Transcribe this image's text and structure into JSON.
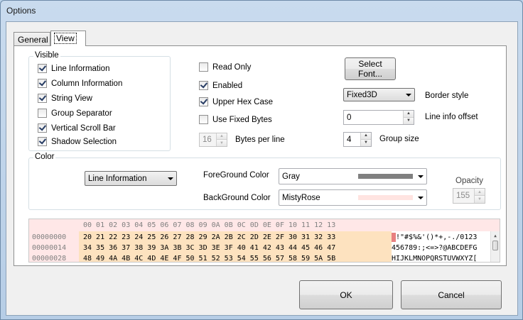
{
  "window": {
    "title": "Options"
  },
  "tabs": [
    {
      "label": "General"
    },
    {
      "label": "View"
    }
  ],
  "visible_group": {
    "title": "Visible",
    "items": [
      {
        "label": "Line Information",
        "checked": true
      },
      {
        "label": "Column Information",
        "checked": true
      },
      {
        "label": "String View",
        "checked": true
      },
      {
        "label": "Group Separator",
        "checked": false
      },
      {
        "label": "Vertical Scroll Bar",
        "checked": true
      },
      {
        "label": "Shadow Selection",
        "checked": true
      }
    ]
  },
  "options": {
    "read_only": {
      "label": "Read Only",
      "checked": false
    },
    "enabled": {
      "label": "Enabled",
      "checked": true
    },
    "upper_hex": {
      "label": "Upper Hex Case",
      "checked": true
    },
    "fixed_bytes": {
      "label": "Use Fixed Bytes",
      "checked": false
    },
    "bytes_per_line": {
      "label": "Bytes per line",
      "value": "16"
    }
  },
  "right": {
    "select_font": "Select Font...",
    "border_style": {
      "label": "Border style",
      "value": "Fixed3D"
    },
    "line_info_offset": {
      "label": "Line info offset",
      "value": "0"
    },
    "group_size": {
      "label": "Group size",
      "value": "4"
    }
  },
  "color_group": {
    "title": "Color",
    "target": "Line Information",
    "foreground": {
      "label": "ForeGround Color",
      "value": "Gray",
      "swatch": "#808080"
    },
    "background": {
      "label": "BackGround Color",
      "value": "MistyRose",
      "swatch": "#ffe4e1"
    },
    "opacity": {
      "label": "Opacity",
      "value": "155"
    }
  },
  "hex_preview": {
    "header": "00 01 02 03 04 05 06 07 08 09 0A 0B 0C 0D 0E 0F 10 11 12 13",
    "rows": [
      {
        "addr": "00000000",
        "bytes": "20 21 22 23 24 25 26 27 28 29 2A 2B 2C 2D 2E 2F 30 31 32 33",
        "ascii": "!\"#$%&'()*+,-./0123"
      },
      {
        "addr": "00000014",
        "bytes": "34 35 36 37 38 39 3A 3B 3C 3D 3E 3F 40 41 42 43 44 45 46 47",
        "ascii": "456789:;<=>?@ABCDEFG"
      },
      {
        "addr": "00000028",
        "bytes": "48 49 4A 4B 4C 4D 4E 4F 50 51 52 53 54 55 56 57 58 59 5A 5B",
        "ascii": "HIJKLMNOPQRSTUVWXYZ["
      }
    ]
  },
  "buttons": {
    "ok": "OK",
    "cancel": "Cancel"
  }
}
